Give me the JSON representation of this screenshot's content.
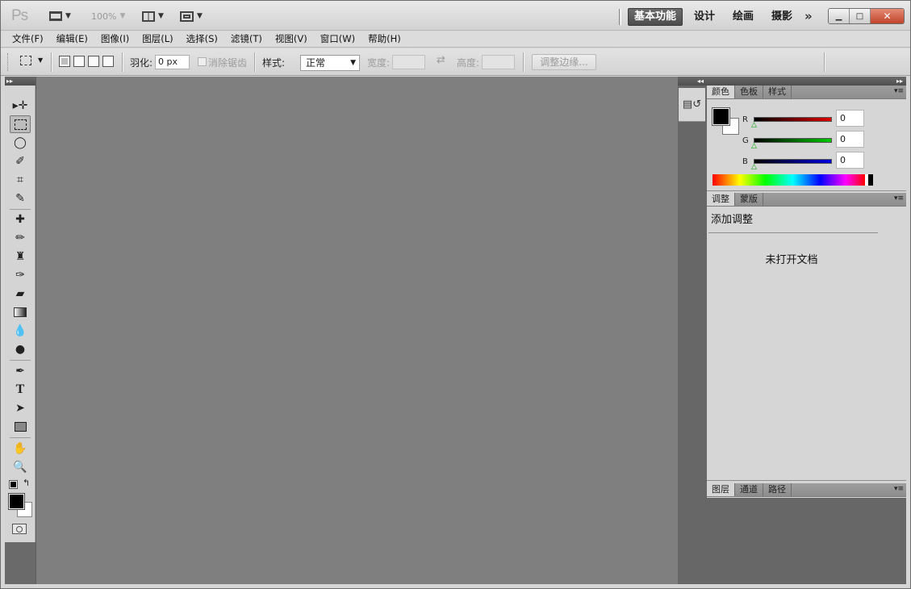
{
  "titlebar": {
    "logo": "Ps",
    "zoom": "100%",
    "workspaces": [
      "基本功能",
      "设计",
      "绘画",
      "摄影"
    ],
    "more": "»",
    "window_buttons": {
      "minimize": "▁",
      "maximize": "□",
      "close": "✕"
    }
  },
  "menu": [
    "文件(F)",
    "编辑(E)",
    "图像(I)",
    "图层(L)",
    "选择(S)",
    "滤镜(T)",
    "视图(V)",
    "窗口(W)",
    "帮助(H)"
  ],
  "options": {
    "feather_label": "羽化:",
    "feather_value": "0 px",
    "antialias_label": "消除锯齿",
    "style_label": "样式:",
    "style_value": "正常",
    "width_label": "宽度:",
    "height_label": "高度:",
    "refine_edge": "调整边缘..."
  },
  "tools_header": "▸▸",
  "dock_header": "◂◂",
  "panel_header": "▸▸",
  "color_panel": {
    "tabs": [
      "颜色",
      "色板",
      "样式"
    ],
    "channels": [
      {
        "label": "R",
        "value": "0",
        "color": "#e00000"
      },
      {
        "label": "G",
        "value": "0",
        "color": "#00c800"
      },
      {
        "label": "B",
        "value": "0",
        "color": "#0000e0"
      }
    ]
  },
  "adjust_panel": {
    "tabs": [
      "调整",
      "蒙版"
    ],
    "title": "添加调整",
    "message": "未打开文档"
  },
  "layers_panel": {
    "tabs": [
      "图层",
      "通道",
      "路径"
    ]
  },
  "panel_menu_icon": "▾≡"
}
